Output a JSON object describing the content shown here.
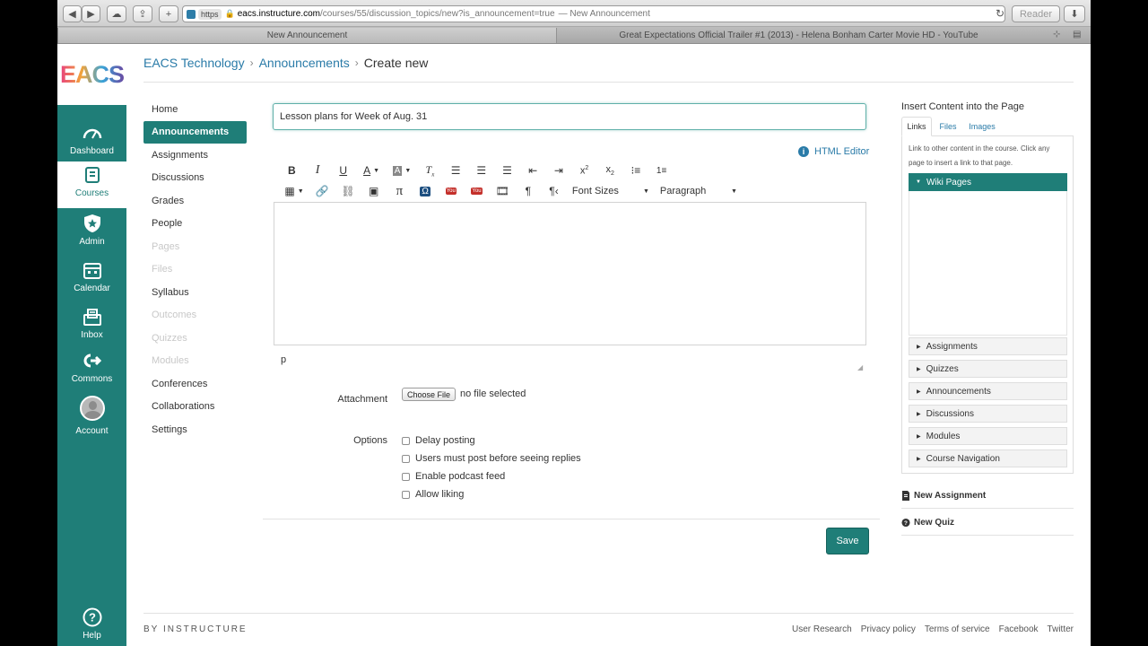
{
  "browser": {
    "url_scheme": "https",
    "url_domain": "eacs.instructure.com",
    "url_path": "/courses/55/discussion_topics/new?is_announcement=true",
    "url_title": "— New Announcement",
    "reader_label": "Reader",
    "tabs": [
      {
        "label": "New Announcement"
      },
      {
        "label": "Great Expectations Official Trailer #1 (2013) - Helena Bonham Carter Movie HD - YouTube"
      }
    ]
  },
  "logo_text": "EACS",
  "globalnav": [
    {
      "label": "Dashboard",
      "icon": "dashboard-icon"
    },
    {
      "label": "Courses",
      "icon": "courses-icon"
    },
    {
      "label": "Admin",
      "icon": "admin-icon"
    },
    {
      "label": "Calendar",
      "icon": "calendar-icon"
    },
    {
      "label": "Inbox",
      "icon": "inbox-icon"
    },
    {
      "label": "Commons",
      "icon": "commons-icon"
    },
    {
      "label": "Account",
      "icon": "avatar"
    },
    {
      "label": "Help",
      "icon": "help-icon"
    }
  ],
  "breadcrumb": {
    "course": "EACS Technology",
    "section": "Announcements",
    "current": "Create new"
  },
  "coursenav": [
    {
      "label": "Home",
      "state": "normal"
    },
    {
      "label": "Announcements",
      "state": "active"
    },
    {
      "label": "Assignments",
      "state": "normal"
    },
    {
      "label": "Discussions",
      "state": "normal"
    },
    {
      "label": "Grades",
      "state": "normal"
    },
    {
      "label": "People",
      "state": "normal"
    },
    {
      "label": "Pages",
      "state": "disabled"
    },
    {
      "label": "Files",
      "state": "disabled"
    },
    {
      "label": "Syllabus",
      "state": "normal"
    },
    {
      "label": "Outcomes",
      "state": "disabled"
    },
    {
      "label": "Quizzes",
      "state": "disabled"
    },
    {
      "label": "Modules",
      "state": "disabled"
    },
    {
      "label": "Conferences",
      "state": "normal"
    },
    {
      "label": "Collaborations",
      "state": "normal"
    },
    {
      "label": "Settings",
      "state": "normal"
    }
  ],
  "form": {
    "title_value": "Lesson plans for Week of Aug. 31",
    "html_editor_label": "HTML Editor",
    "toolbar": {
      "font_sizes": "Font Sizes",
      "paragraph": "Paragraph"
    },
    "path_label": "p",
    "attachment_label": "Attachment",
    "choose_file_label": "Choose File",
    "no_file_label": "no file selected",
    "options_label": "Options",
    "options": [
      {
        "label": "Delay posting",
        "checked": false
      },
      {
        "label": "Users must post before seeing replies",
        "checked": false
      },
      {
        "label": "Enable podcast feed",
        "checked": false
      },
      {
        "label": "Allow liking",
        "checked": false
      }
    ],
    "save_label": "Save"
  },
  "sidebar": {
    "title": "Insert Content into the Page",
    "tabs": [
      {
        "label": "Links",
        "active": true
      },
      {
        "label": "Files",
        "active": false
      },
      {
        "label": "Images",
        "active": false
      }
    ],
    "help_text": "Link to other content in the course. Click any page to insert a link to that page.",
    "expanded_section": "Wiki Pages",
    "sections": [
      "Assignments",
      "Quizzes",
      "Announcements",
      "Discussions",
      "Modules",
      "Course Navigation"
    ],
    "actions": [
      {
        "label": "New Assignment",
        "icon": "new-assignment-icon"
      },
      {
        "label": "New Quiz",
        "icon": "new-quiz-icon"
      }
    ]
  },
  "footer": {
    "brand": "BY INSTRUCTURE",
    "links": [
      "User Research",
      "Privacy policy",
      "Terms of service",
      "Facebook",
      "Twitter"
    ]
  },
  "colors": {
    "brand_teal": "#1f7e78",
    "link_blue": "#2a7ba8"
  }
}
